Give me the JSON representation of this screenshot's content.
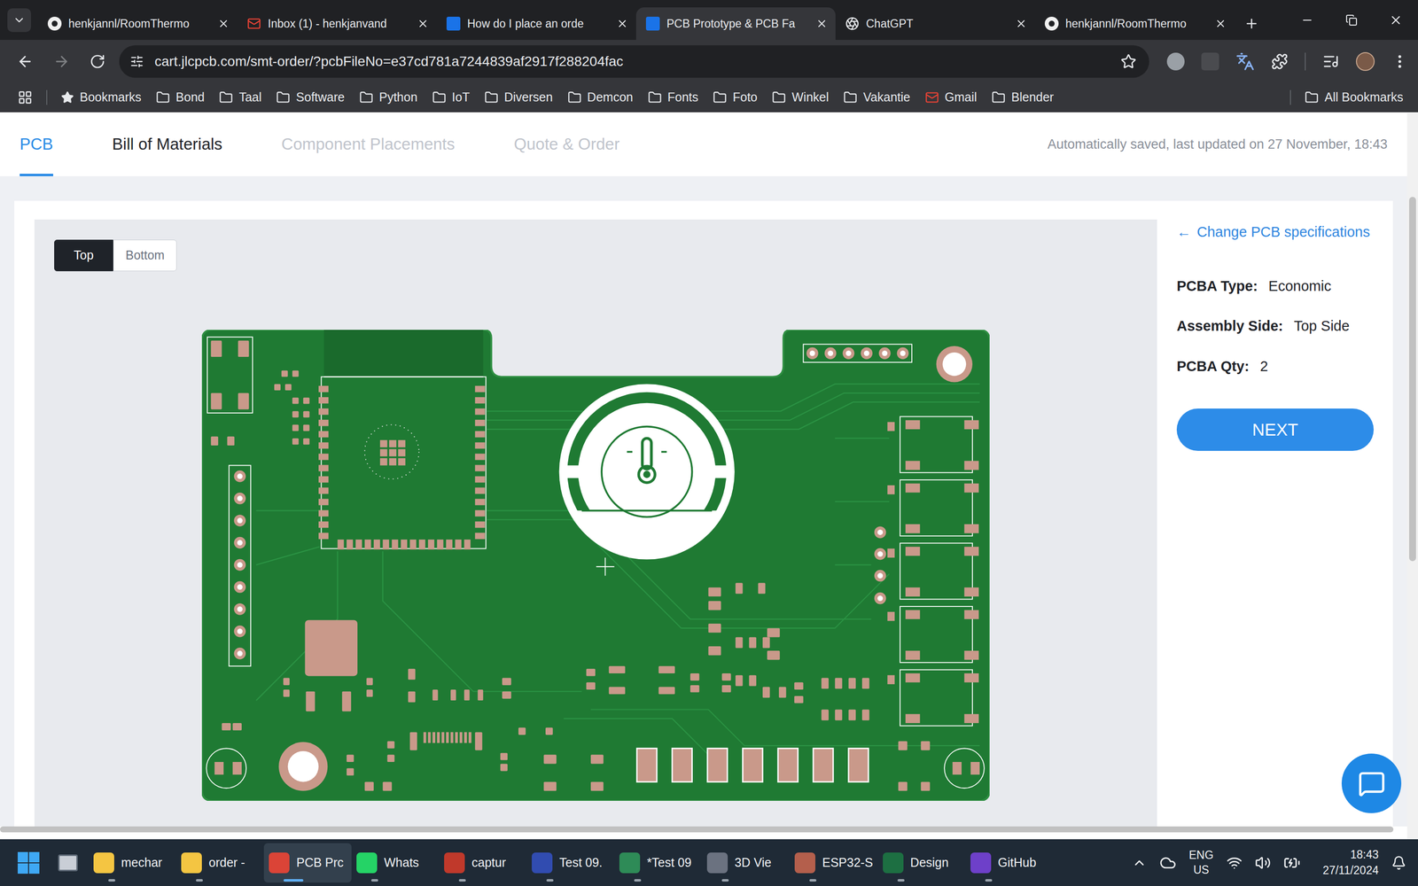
{
  "window": {
    "title": "PCB Prototype & PCB Fa"
  },
  "tabs": [
    {
      "label": "henkjannl/RoomThermo",
      "favicon": "github",
      "selected": false
    },
    {
      "label": "Inbox (1) - henkjanvand",
      "favicon": "gmail",
      "selected": false
    },
    {
      "label": "How do I place an orde",
      "favicon": "jlc",
      "selected": false
    },
    {
      "label": "PCB Prototype & PCB Fa",
      "favicon": "jlc",
      "selected": true
    },
    {
      "label": "ChatGPT",
      "favicon": "chatgpt",
      "selected": false
    },
    {
      "label": "henkjannl/RoomThermo",
      "favicon": "github",
      "selected": false
    }
  ],
  "address_bar": {
    "url": "cart.jlcpcb.com/smt-order/?pcbFileNo=e37cd781a7244839af2917f288204fac"
  },
  "bookmarks": {
    "items": [
      {
        "label": "Bookmarks",
        "kind": "star"
      },
      {
        "label": "Bond",
        "kind": "folder"
      },
      {
        "label": "Taal",
        "kind": "folder"
      },
      {
        "label": "Software",
        "kind": "folder"
      },
      {
        "label": "Python",
        "kind": "folder"
      },
      {
        "label": "IoT",
        "kind": "folder"
      },
      {
        "label": "Diversen",
        "kind": "folder"
      },
      {
        "label": "Demcon",
        "kind": "folder"
      },
      {
        "label": "Fonts",
        "kind": "folder"
      },
      {
        "label": "Foto",
        "kind": "folder"
      },
      {
        "label": "Winkel",
        "kind": "folder"
      },
      {
        "label": "Vakantie",
        "kind": "folder"
      },
      {
        "label": "Gmail",
        "kind": "gmail"
      },
      {
        "label": "Blender",
        "kind": "folder"
      }
    ],
    "all_bookmarks": "All Bookmarks"
  },
  "page": {
    "steps": [
      {
        "label": "PCB",
        "selected": true,
        "disabled": false
      },
      {
        "label": "Bill of Materials",
        "selected": false,
        "disabled": false
      },
      {
        "label": "Component Placements",
        "selected": false,
        "disabled": true
      },
      {
        "label": "Quote & Order",
        "selected": false,
        "disabled": true
      }
    ],
    "save_status": "Automatically saved, last updated on 27 November, 18:43",
    "side_toggle": [
      {
        "label": "Top",
        "selected": true
      },
      {
        "label": "Bottom",
        "selected": false
      }
    ],
    "change_link": {
      "arrow": "←",
      "label": "Change PCB specifications"
    },
    "specs": [
      {
        "label": "PCBA Type:",
        "value": "Economic"
      },
      {
        "label": "Assembly Side:",
        "value": "Top Side"
      },
      {
        "label": "PCBA Qty:",
        "value": "2"
      }
    ],
    "next_button": "NEXT"
  },
  "taskbar": {
    "apps": [
      {
        "label": "mechar",
        "color": "#f4c542",
        "selected": false
      },
      {
        "label": "order -",
        "color": "#f4c542",
        "selected": false
      },
      {
        "label": "PCB Prc",
        "color": "#db4437",
        "selected": true
      },
      {
        "label": "Whats",
        "color": "#25d366",
        "selected": false
      },
      {
        "label": "captur",
        "color": "#c0392b",
        "selected": false
      },
      {
        "label": "Test 09.",
        "color": "#314cb0",
        "selected": false
      },
      {
        "label": "*Test 09",
        "color": "#2e8b57",
        "selected": false
      },
      {
        "label": "3D Vie",
        "color": "#6b7280",
        "selected": false
      },
      {
        "label": "ESP32-S",
        "color": "#b45f4c",
        "selected": false
      },
      {
        "label": "Design",
        "color": "#1d6f42",
        "selected": false
      },
      {
        "label": "GitHub",
        "color": "#6e40c9",
        "selected": false
      }
    ],
    "language": [
      "ENG",
      "US"
    ],
    "time": "18:43",
    "date": "27/11/2024"
  }
}
